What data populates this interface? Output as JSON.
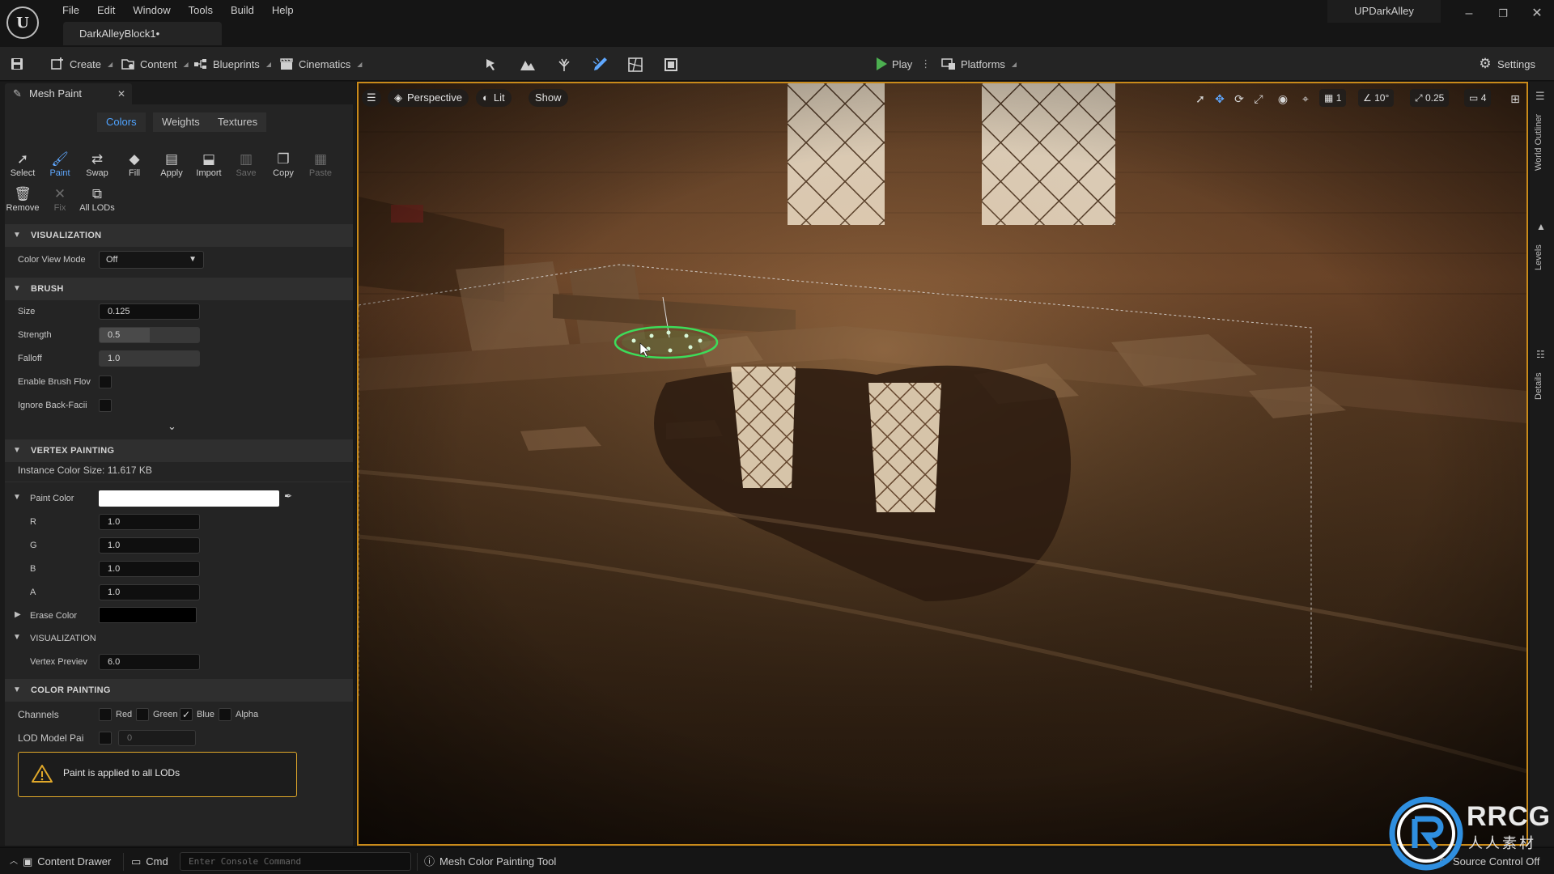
{
  "app": {
    "logo_text": "U",
    "menu": [
      "File",
      "Edit",
      "Window",
      "Tools",
      "Build",
      "Help"
    ],
    "document_tab": "DarkAlleyBlock1•",
    "project_name": "UPDarkAlley",
    "window_controls": {
      "minimize": "–",
      "restore": "❐",
      "close": "✕"
    }
  },
  "toolbar": {
    "save_icon": "save-icon",
    "create": "Create",
    "content": "Content",
    "blueprints": "Blueprints",
    "cinematics": "Cinematics",
    "modes": [
      "select-mode-icon",
      "landscape-mode-icon",
      "foliage-mode-icon",
      "mesh-paint-mode-icon",
      "fracture-mode-icon",
      "modeling-mode-icon"
    ],
    "play": "Play",
    "platforms": "Platforms",
    "settings": "Settings"
  },
  "mesh_paint_panel": {
    "tab_title": "Mesh Paint",
    "segments": [
      "Colors",
      "Weights",
      "Textures"
    ],
    "active_segment": "Colors",
    "tools_row1": [
      {
        "label": "Select",
        "icon": "cursor-icon",
        "state": "normal"
      },
      {
        "label": "Paint",
        "icon": "brush-icon",
        "state": "active"
      },
      {
        "label": "Swap",
        "icon": "swap-icon",
        "state": "normal"
      },
      {
        "label": "Fill",
        "icon": "fill-bucket-icon",
        "state": "normal"
      },
      {
        "label": "Apply",
        "icon": "apply-icon",
        "state": "normal"
      },
      {
        "label": "Import",
        "icon": "import-icon",
        "state": "normal"
      },
      {
        "label": "Save",
        "icon": "save-icon",
        "state": "disabled"
      },
      {
        "label": "Copy",
        "icon": "copy-icon",
        "state": "normal"
      },
      {
        "label": "Paste",
        "icon": "paste-icon",
        "state": "disabled"
      }
    ],
    "tools_row2": [
      {
        "label": "Remove",
        "icon": "trash-icon",
        "state": "normal"
      },
      {
        "label": "Fix",
        "icon": "wrench-icon",
        "state": "disabled"
      },
      {
        "label": "All LODs",
        "icon": "lods-icon",
        "state": "normal"
      }
    ],
    "visualization": {
      "header": "VISUALIZATION",
      "color_view_mode_label": "Color View Mode",
      "color_view_mode_value": "Off"
    },
    "brush": {
      "header": "BRUSH",
      "size_label": "Size",
      "size_value": "0.125",
      "strength_label": "Strength",
      "strength_value": "0.5",
      "strength_fraction": 0.5,
      "falloff_label": "Falloff",
      "falloff_value": "1.0",
      "enable_brush_flow_label": "Enable Brush Flov",
      "ignore_back_facing_label": "Ignore Back-Facii",
      "expand_icon": "chevron-down-icon"
    },
    "vertex_painting": {
      "header": "VERTEX PAINTING",
      "instance_color_size": "Instance Color Size: 11.617 KB",
      "paint_color_label": "Paint Color",
      "paint_color_hex": "#ffffff",
      "channels": [
        {
          "label": "R",
          "value": "1.0"
        },
        {
          "label": "G",
          "value": "1.0"
        },
        {
          "label": "B",
          "value": "1.0"
        },
        {
          "label": "A",
          "value": "1.0"
        }
      ],
      "erase_color_label": "Erase Color",
      "erase_color_hex": "#000000",
      "sub_visualization_header": "VISUALIZATION",
      "vertex_preview_label": "Vertex Previev",
      "vertex_preview_value": "6.0"
    },
    "color_painting": {
      "header": "COLOR PAINTING",
      "channels_label": "Channels",
      "channel_options": [
        {
          "label": "Red",
          "checked": false
        },
        {
          "label": "Green",
          "checked": false
        },
        {
          "label": "Blue",
          "checked": true
        },
        {
          "label": "Alpha",
          "checked": false
        }
      ],
      "lod_model_label": "LOD Model Pai",
      "lod_model_value": "0",
      "warning_text": "Paint is applied to all LODs"
    }
  },
  "viewport": {
    "perspective": "Perspective",
    "lit": "Lit",
    "show": "Show",
    "grid_snap": "1",
    "rotation_snap": "10°",
    "scale_snap": "0.25",
    "camera_speed": "4"
  },
  "side_tabs": [
    "World Outliner",
    "Levels",
    "Details"
  ],
  "statusbar": {
    "content_drawer": "Content Drawer",
    "cmd": "Cmd",
    "console_placeholder": "Enter Console Command",
    "tool_name": "Mesh Color Painting Tool",
    "source_control": "Source Control Off"
  },
  "watermark": {
    "text": "RRCG",
    "sub": "人人素材"
  },
  "colors": {
    "accent_blue": "#4fa3ff",
    "viewport_border": "#c98a1a",
    "warning": "#e0a82a",
    "play_green": "#4caf50",
    "brush_ring": "#3ddc5a"
  }
}
